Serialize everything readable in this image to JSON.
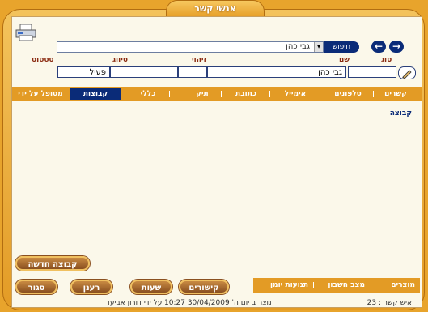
{
  "window": {
    "title": "אנשי קשר"
  },
  "toolbar": {
    "search_label": "חיפוש",
    "search_value": "גבי כהן",
    "back_label": "←",
    "forward_label": "→"
  },
  "fields": {
    "labels": [
      "סוג",
      "שם",
      "זיהוי",
      "סיווג",
      "סטטוס"
    ],
    "values": {
      "type": "",
      "name": "גבי כהן",
      "id": "",
      "classification": "",
      "status": "פעיל"
    }
  },
  "tabs": [
    "קשרים",
    "טלפונים",
    "אימייל",
    "כתובת",
    "תיק",
    "כללי",
    "קבוצות",
    "מטופל על ידי"
  ],
  "active_tab": "קבוצות",
  "content": {
    "column_header": "קבוצה"
  },
  "buttons": {
    "new_group": "קבוצה חדשה",
    "links": "קישורים",
    "hours": "שעות",
    "refresh": "רענן",
    "close": "סגור"
  },
  "footer_links": [
    "מוצרים",
    "מצב חשבון",
    "תנועות יומן"
  ],
  "status": {
    "contact_id": "איש קשר : 23",
    "created": "נוצר ב יום ה' 30/04/2009 10:27",
    "created_by": "על ידי דורון אביעד"
  },
  "colors": {
    "accent": "#e39b25",
    "navy": "#0a2b78",
    "panel": "#fbf8ea"
  }
}
